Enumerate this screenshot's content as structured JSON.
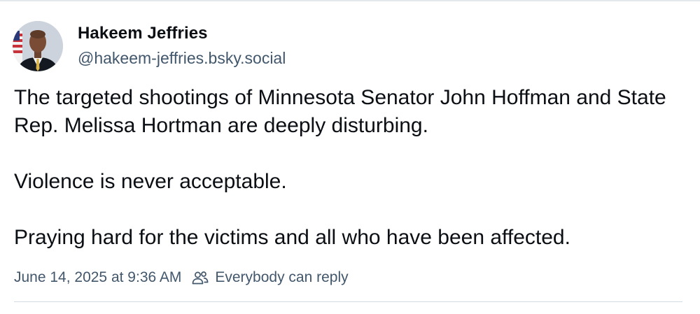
{
  "post": {
    "author": {
      "display_name": "Hakeem Jeffries",
      "handle": "@hakeem-jeffries.bsky.social",
      "avatar_icon": "profile-photo"
    },
    "body": {
      "paragraphs": [
        "The targeted shootings of Minnesota Senator John Hoffman and State Rep. Melissa Hortman are deeply disturbing.",
        "Violence is never acceptable.",
        "Praying hard for the victims and all who have been affected."
      ]
    },
    "meta": {
      "timestamp": "June 14, 2025 at 9:36 AM",
      "reply_setting_icon": "people-icon",
      "reply_setting": "Everybody can reply"
    }
  },
  "colors": {
    "text_primary": "#0b0f14",
    "text_secondary": "#42576c",
    "divider": "#d4dbe2"
  }
}
